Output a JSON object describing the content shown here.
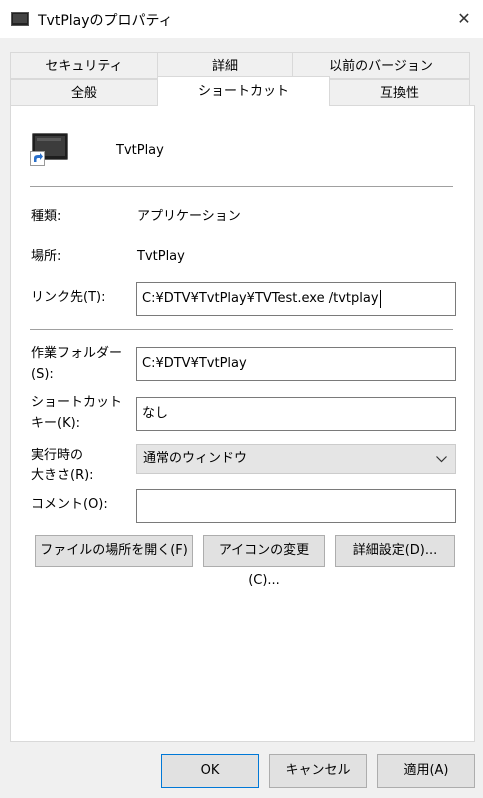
{
  "window": {
    "title": "TvtPlayのプロパティ",
    "close_glyph": "✕"
  },
  "tabs": {
    "row1": [
      "セキュリティ",
      "詳細",
      "以前のバージョン"
    ],
    "row2": [
      "全般",
      "ショートカット",
      "互換性"
    ],
    "active": "ショートカット"
  },
  "header": {
    "name": "TvtPlay",
    "icon": "shortcut-app-icon"
  },
  "fields": {
    "type_label": "種類:",
    "type_value": "アプリケーション",
    "location_label": "場所:",
    "location_value": "TvtPlay",
    "target_label": "リンク先(T):",
    "target_value": "C:¥DTV¥TvtPlay¥TVTest.exe /tvtplay",
    "workdir_label_1": "作業フォルダー",
    "workdir_label_2": "(S):",
    "workdir_value": "C:¥DTV¥TvtPlay",
    "shortcut_label_1": "ショートカット",
    "shortcut_label_2": "キー(K):",
    "shortcut_value": "なし",
    "run_label_1": "実行時の",
    "run_label_2": "大きさ(R):",
    "run_value": "通常のウィンドウ",
    "comment_label": "コメント(O):",
    "comment_value": ""
  },
  "actions": {
    "open_location": "ファイルの場所を開く(F)",
    "change_icon": "アイコンの変更(C)...",
    "advanced": "詳細設定(D)..."
  },
  "footer": {
    "ok": "OK",
    "cancel": "キャンセル",
    "apply": "適用(A)"
  },
  "colors": {
    "accent": "#0078d7",
    "panel": "#ffffff",
    "window": "#f0f0f0"
  }
}
